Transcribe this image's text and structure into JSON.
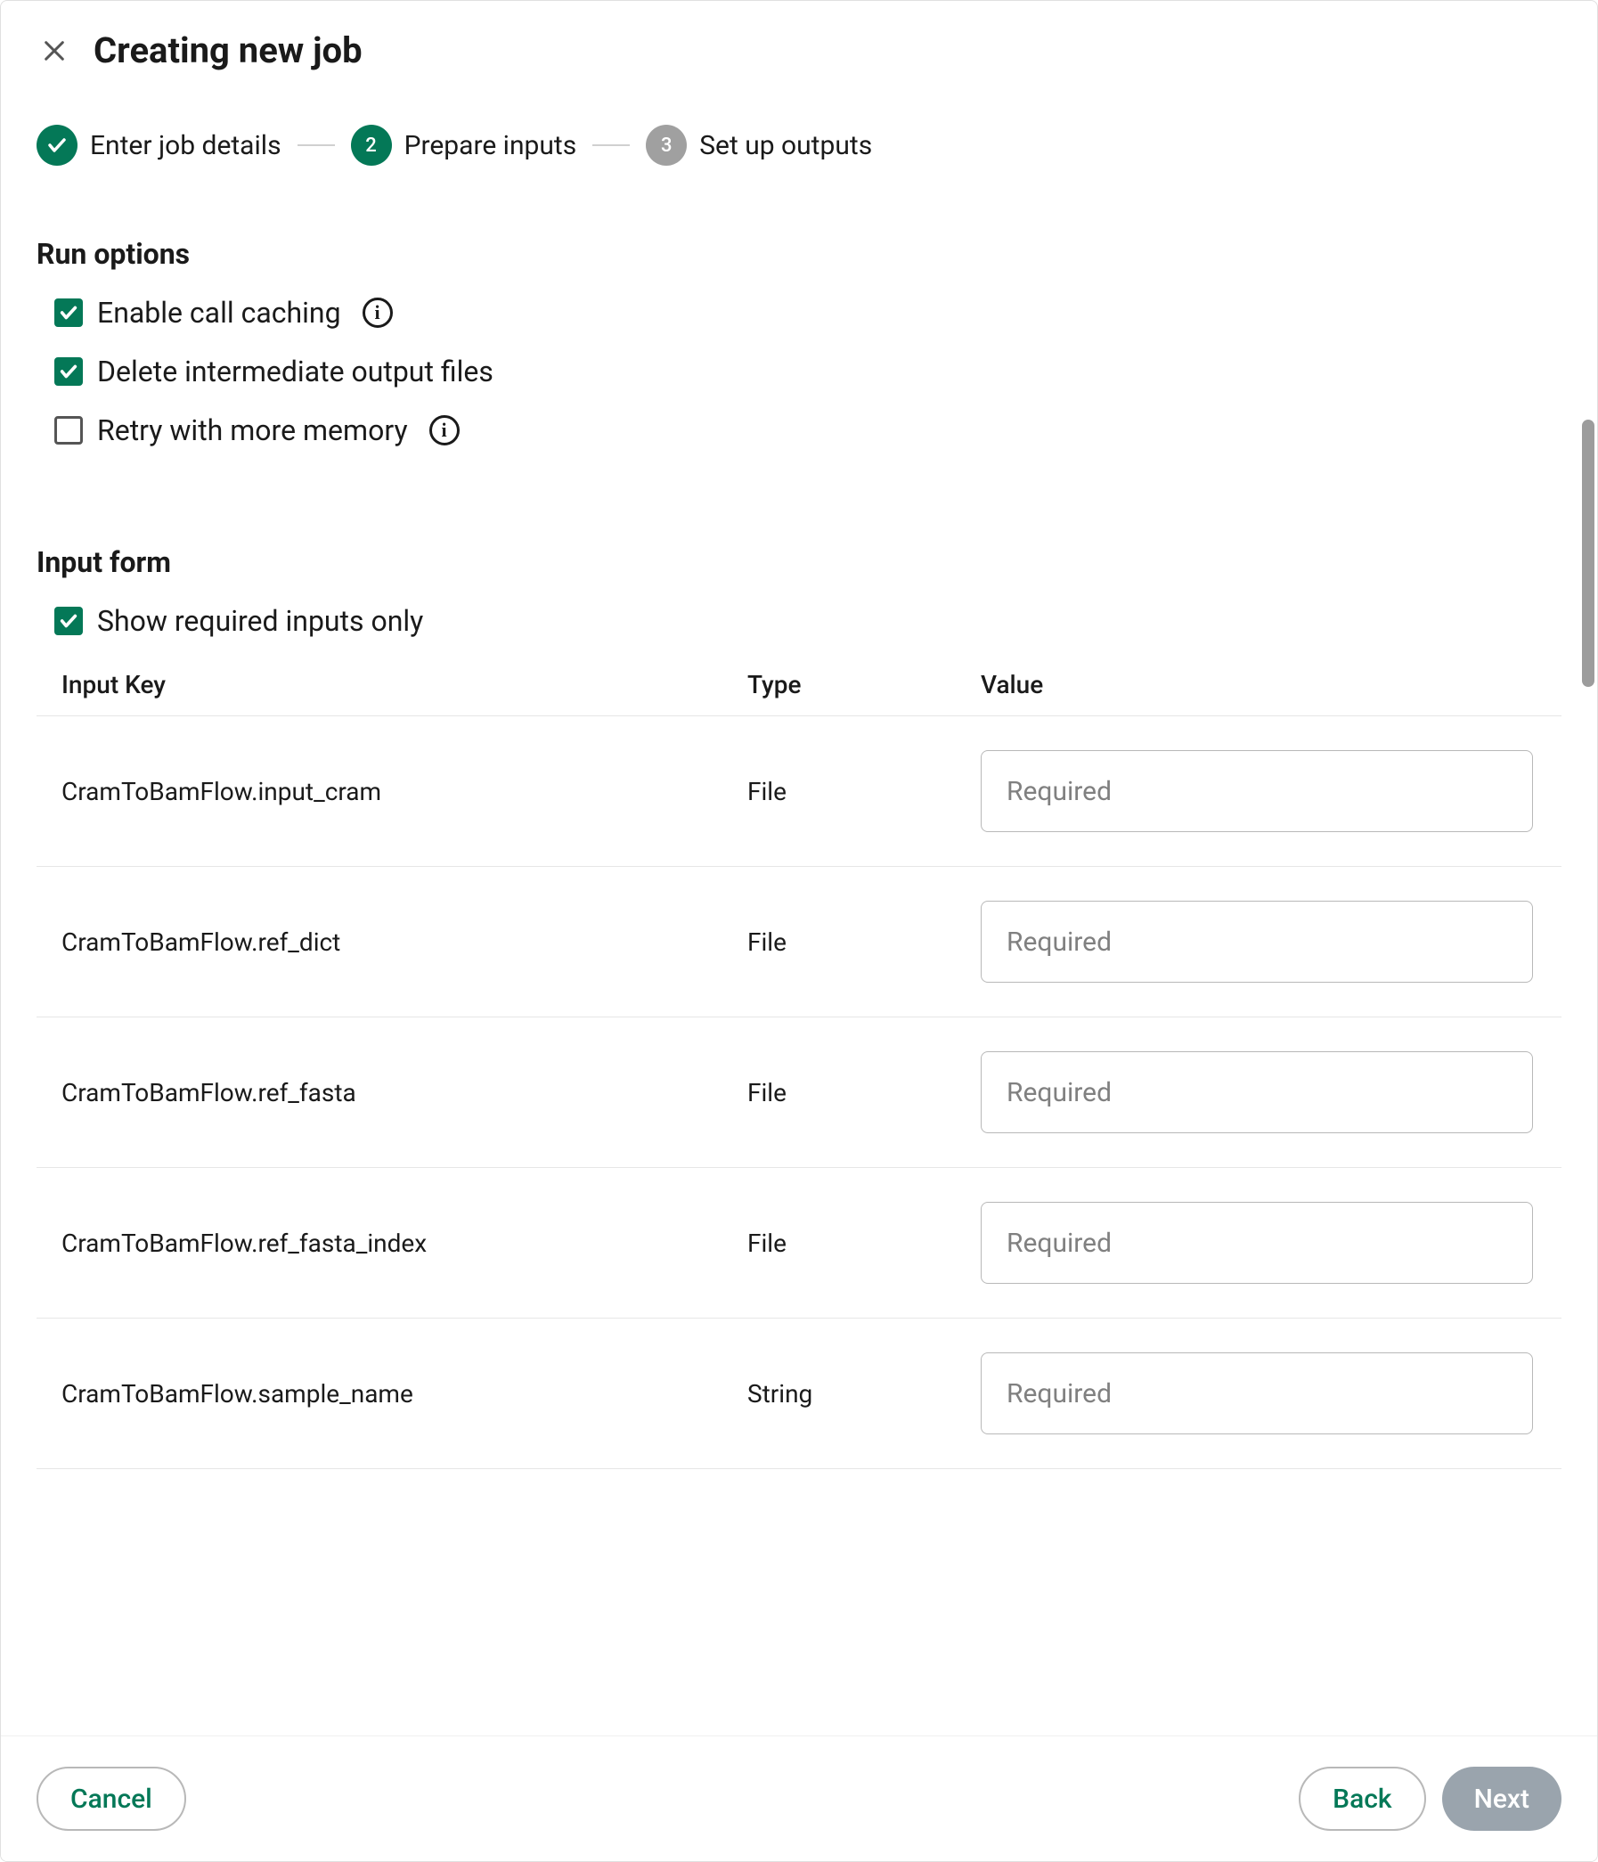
{
  "header": {
    "title": "Creating new job"
  },
  "stepper": {
    "steps": [
      {
        "label": "Enter job details",
        "number": "1",
        "state": "done"
      },
      {
        "label": "Prepare inputs",
        "number": "2",
        "state": "current"
      },
      {
        "label": "Set up outputs",
        "number": "3",
        "state": "pending"
      }
    ]
  },
  "run_options": {
    "title": "Run options",
    "items": [
      {
        "label": "Enable call caching",
        "checked": true,
        "has_info": true
      },
      {
        "label": "Delete intermediate output files",
        "checked": true,
        "has_info": false
      },
      {
        "label": "Retry with more memory",
        "checked": false,
        "has_info": true
      }
    ]
  },
  "input_form": {
    "title": "Input form",
    "filter": {
      "label": "Show required inputs only",
      "checked": true
    },
    "columns": {
      "key": "Input Key",
      "type": "Type",
      "value": "Value"
    },
    "placeholder": "Required",
    "rows": [
      {
        "key": "CramToBamFlow.input_cram",
        "type": "File",
        "value": ""
      },
      {
        "key": "CramToBamFlow.ref_dict",
        "type": "File",
        "value": ""
      },
      {
        "key": "CramToBamFlow.ref_fasta",
        "type": "File",
        "value": ""
      },
      {
        "key": "CramToBamFlow.ref_fasta_index",
        "type": "File",
        "value": ""
      },
      {
        "key": "CramToBamFlow.sample_name",
        "type": "String",
        "value": ""
      }
    ]
  },
  "footer": {
    "cancel": "Cancel",
    "back": "Back",
    "next": "Next"
  }
}
